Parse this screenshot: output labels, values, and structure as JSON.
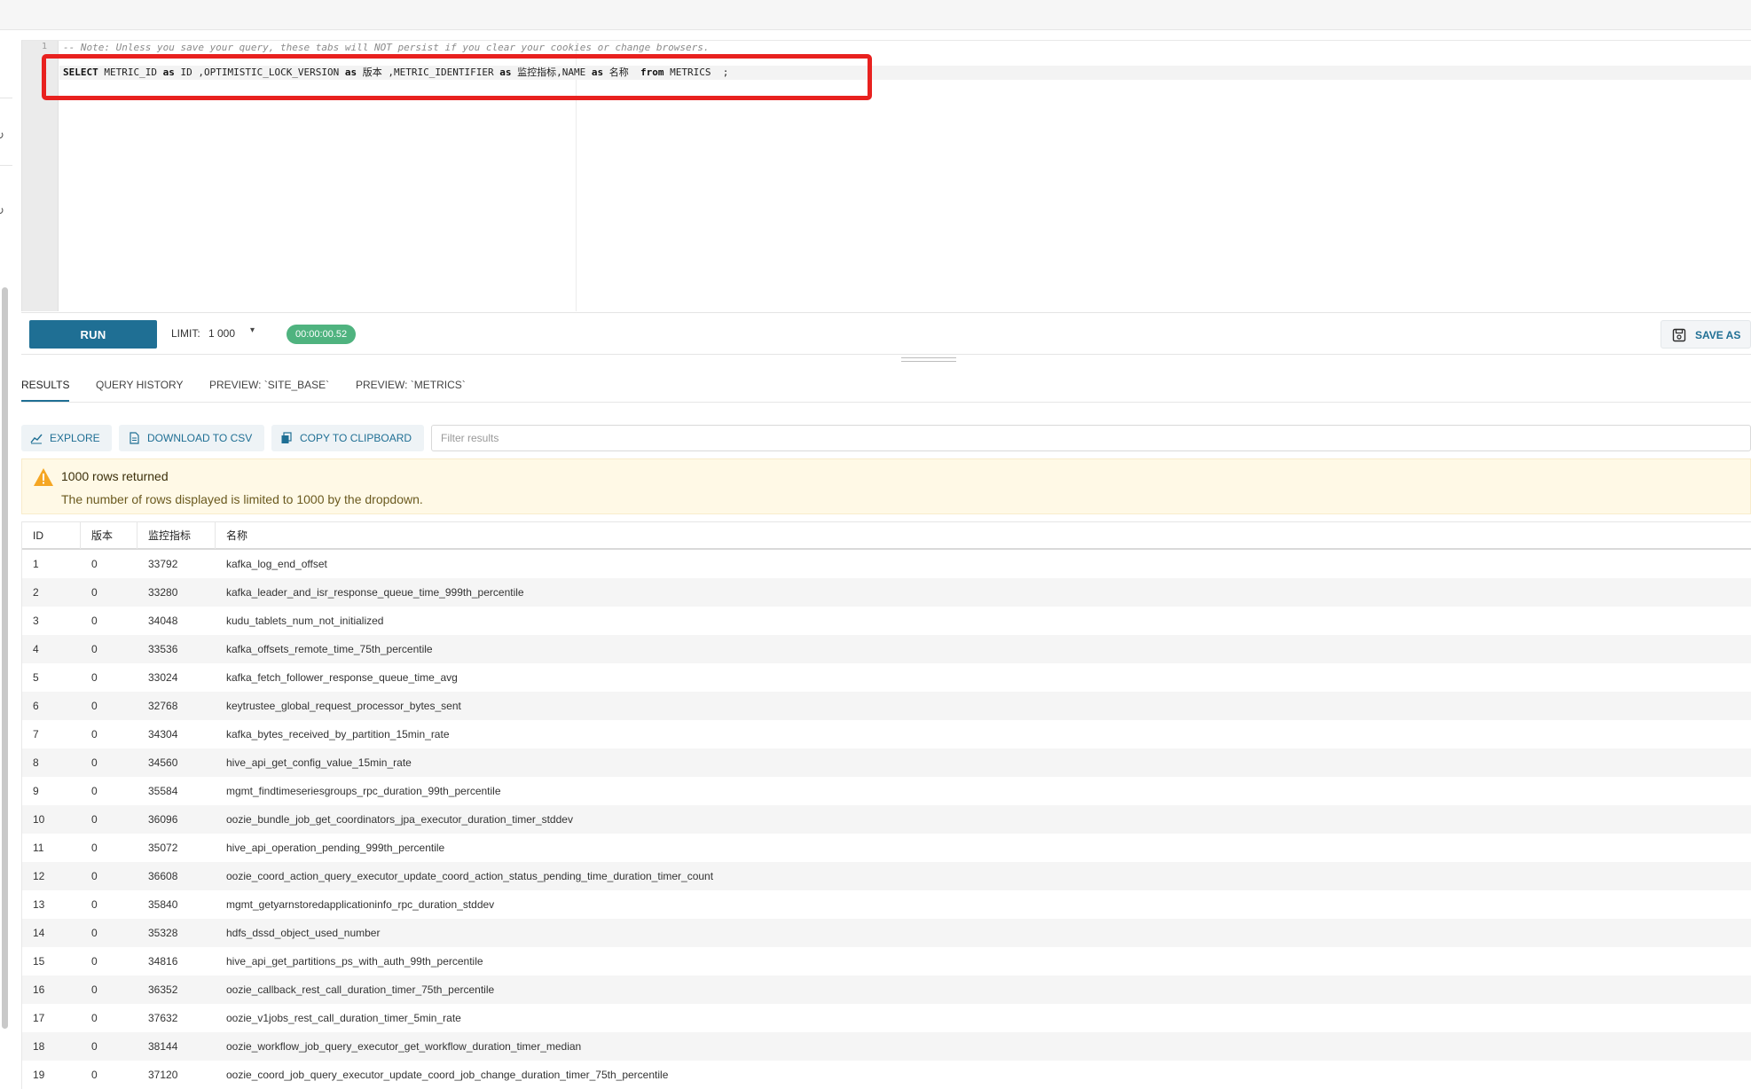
{
  "editor": {
    "lines": [
      {
        "num": "1",
        "text": "-- Note: Unless you save your query, these tabs will NOT persist if you clear your cookies or change browsers."
      },
      {
        "num": "2",
        "tokens": [
          {
            "k": "kw",
            "t": "SELECT"
          },
          {
            "k": "tx",
            "t": " METRIC_ID "
          },
          {
            "k": "kw",
            "t": "as"
          },
          {
            "k": "tx",
            "t": " ID ,OPTIMISTIC_LOCK_VERSION "
          },
          {
            "k": "kw",
            "t": "as"
          },
          {
            "k": "tx",
            "t": " 版本 ,METRIC_IDENTIFIER "
          },
          {
            "k": "kw",
            "t": "as"
          },
          {
            "k": "tx",
            "t": " 监控指标,NAME "
          },
          {
            "k": "kw",
            "t": "as"
          },
          {
            "k": "tx",
            "t": " 名称  "
          },
          {
            "k": "kw",
            "t": "from"
          },
          {
            "k": "tx",
            "t": " METRICS  ;"
          }
        ]
      }
    ]
  },
  "toolbar": {
    "run_label": "RUN",
    "limit_label": "LIMIT:",
    "limit_value": "1 000",
    "timer": "00:00:00.52",
    "save_as_label": "SAVE AS"
  },
  "tabs": [
    {
      "label": "RESULTS",
      "active": true
    },
    {
      "label": "QUERY HISTORY",
      "active": false
    },
    {
      "label": "PREVIEW: `SITE_BASE`",
      "active": false
    },
    {
      "label": "PREVIEW: `METRICS`",
      "active": false
    }
  ],
  "actions": {
    "explore_label": "EXPLORE",
    "download_label": "DOWNLOAD TO CSV",
    "copy_label": "COPY TO CLIPBOARD",
    "filter_placeholder": "Filter results"
  },
  "alert": {
    "title": "1000 rows returned",
    "message": "The number of rows displayed is limited to 1000 by the dropdown."
  },
  "table": {
    "columns": [
      "ID",
      "版本",
      "监控指标",
      "名称"
    ],
    "rows": [
      [
        "1",
        "0",
        "33792",
        "kafka_log_end_offset"
      ],
      [
        "2",
        "0",
        "33280",
        "kafka_leader_and_isr_response_queue_time_999th_percentile"
      ],
      [
        "3",
        "0",
        "34048",
        "kudu_tablets_num_not_initialized"
      ],
      [
        "4",
        "0",
        "33536",
        "kafka_offsets_remote_time_75th_percentile"
      ],
      [
        "5",
        "0",
        "33024",
        "kafka_fetch_follower_response_queue_time_avg"
      ],
      [
        "6",
        "0",
        "32768",
        "keytrustee_global_request_processor_bytes_sent"
      ],
      [
        "7",
        "0",
        "34304",
        "kafka_bytes_received_by_partition_15min_rate"
      ],
      [
        "8",
        "0",
        "34560",
        "hive_api_get_config_value_15min_rate"
      ],
      [
        "9",
        "0",
        "35584",
        "mgmt_findtimeseriesgroups_rpc_duration_99th_percentile"
      ],
      [
        "10",
        "0",
        "36096",
        "oozie_bundle_job_get_coordinators_jpa_executor_duration_timer_stddev"
      ],
      [
        "11",
        "0",
        "35072",
        "hive_api_operation_pending_999th_percentile"
      ],
      [
        "12",
        "0",
        "36608",
        "oozie_coord_action_query_executor_update_coord_action_status_pending_time_duration_timer_count"
      ],
      [
        "13",
        "0",
        "35840",
        "mgmt_getyarnstoredapplicationinfo_rpc_duration_stddev"
      ],
      [
        "14",
        "0",
        "35328",
        "hdfs_dssd_object_used_number"
      ],
      [
        "15",
        "0",
        "34816",
        "hive_api_get_partitions_ps_with_auth_99th_percentile"
      ],
      [
        "16",
        "0",
        "36352",
        "oozie_callback_rest_call_duration_timer_75th_percentile"
      ],
      [
        "17",
        "0",
        "37632",
        "oozie_v1jobs_rest_call_duration_timer_5min_rate"
      ],
      [
        "18",
        "0",
        "38144",
        "oozie_workflow_job_query_executor_get_workflow_duration_timer_median"
      ],
      [
        "19",
        "0",
        "37120",
        "oozie_coord_job_query_executor_update_coord_job_change_duration_timer_75th_percentile"
      ]
    ]
  },
  "colors": {
    "accent": "#1f6f94",
    "timer": "#4fb37f",
    "highlight": "#e8211f",
    "warning": "#f5a623"
  }
}
